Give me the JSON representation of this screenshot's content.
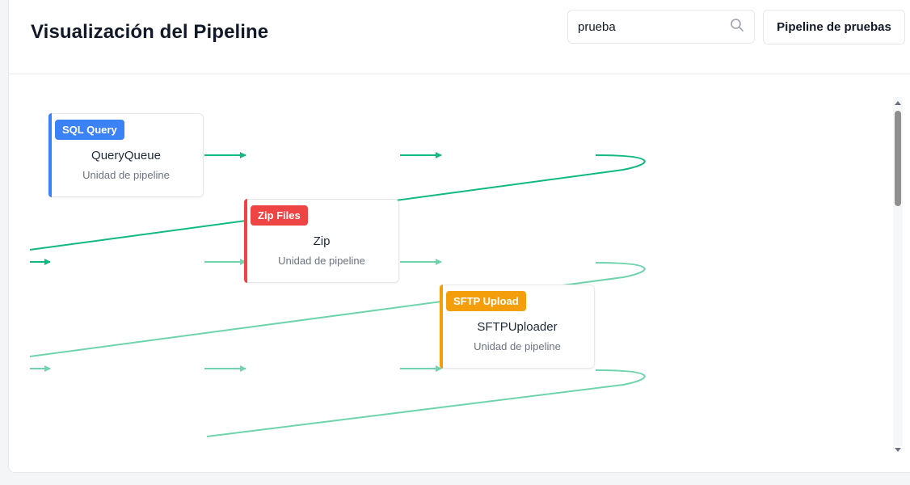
{
  "header": {
    "title": "Visualización del Pipeline",
    "search": {
      "value": "prueba",
      "icon": "search-icon"
    },
    "pipeline_button_label": "Pipeline de pruebas"
  },
  "nodes": [
    {
      "badge": "SQL Query",
      "name": "QueryQueue",
      "subtitle": "Unidad de pipeline",
      "color": "#3b82f6"
    },
    {
      "badge": "Zip Files",
      "name": "Zip",
      "subtitle": "Unidad de pipeline",
      "color": "#ef4444"
    },
    {
      "badge": "SFTP Upload",
      "name": "SFTPUploader",
      "subtitle": "Unidad de pipeline",
      "color": "#f59e0b"
    }
  ],
  "colors": {
    "edge_primary": "#10b981",
    "edge_secondary": "#6fd4ae",
    "scroll_thumb": "#8f8f8f"
  }
}
